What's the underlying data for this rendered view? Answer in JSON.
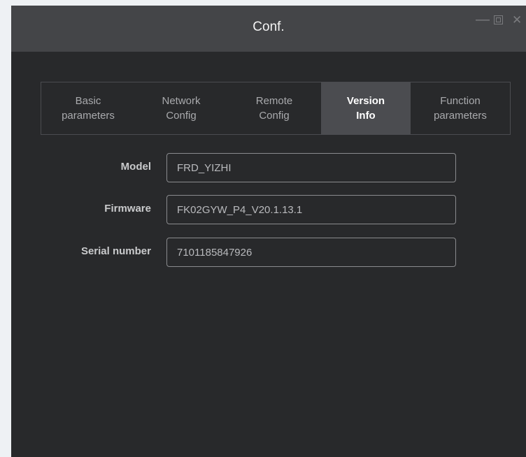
{
  "window": {
    "title": "Conf.",
    "controls": {
      "minimize": "—",
      "close": "✕"
    }
  },
  "tabs": [
    {
      "label": "Basic\nparameters",
      "active": false
    },
    {
      "label": "Network\nConfig",
      "active": false
    },
    {
      "label": "Remote\nConfig",
      "active": false
    },
    {
      "label": "Version\nInfo",
      "active": true
    },
    {
      "label": "Function\nparameters",
      "active": false
    }
  ],
  "version_info": {
    "model": {
      "label": "Model",
      "value": "FRD_YIZHI"
    },
    "firmware": {
      "label": "Firmware",
      "value": "FK02GYW_P4_V20.1.13.1"
    },
    "serial": {
      "label": "Serial number",
      "value": "7101185847926"
    }
  },
  "colors": {
    "window_bg": "#28292b",
    "titlebar_bg": "#444548",
    "active_tab_bg": "#4b4c50",
    "input_border": "#8a8b8e"
  }
}
